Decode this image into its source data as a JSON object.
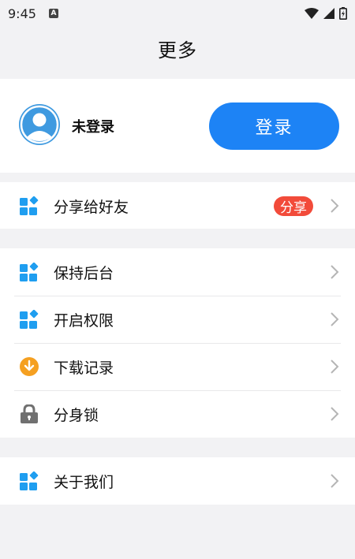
{
  "status_bar": {
    "time": "9:45",
    "badge": "A"
  },
  "header": {
    "title": "更多"
  },
  "profile": {
    "name": "未登录",
    "login_label": "登录"
  },
  "share": {
    "label": "分享给好友",
    "badge": "分享"
  },
  "settings": [
    {
      "label": "保持后台",
      "icon": "grid-icon"
    },
    {
      "label": "开启权限",
      "icon": "grid-icon"
    },
    {
      "label": "下载记录",
      "icon": "download-icon"
    },
    {
      "label": "分身锁",
      "icon": "lock-icon"
    }
  ],
  "about": {
    "label": "关于我们"
  },
  "colors": {
    "accent": "#1d83f5",
    "badge": "#f24b3a",
    "icon_blue": "#1f9ef0",
    "icon_orange": "#f5a021",
    "icon_gray": "#707070"
  }
}
